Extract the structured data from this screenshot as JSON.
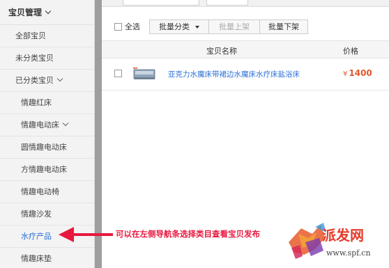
{
  "sidebar": {
    "header": "宝贝管理",
    "items": [
      {
        "label": "全部宝贝"
      },
      {
        "label": "未分类宝贝"
      },
      {
        "label": "已分类宝贝"
      },
      {
        "label": "情趣红床"
      },
      {
        "label": "情趣电动床"
      },
      {
        "label": "圆情趣电动床"
      },
      {
        "label": "方情趣电动床"
      },
      {
        "label": "情趣电动椅"
      },
      {
        "label": "情趣沙发"
      },
      {
        "label": "水疗产品"
      },
      {
        "label": "情趣床垫"
      }
    ]
  },
  "toolbar": {
    "select_all": "全选",
    "batch_category": "批量分类",
    "batch_list": "批量上架",
    "batch_delist": "批量下架"
  },
  "table": {
    "headers": [
      "宝贝名称",
      "价格"
    ],
    "rows": [
      {
        "name": "亚克力水魔床带裙边水魔床水疗床盐浴床",
        "currency": "¥",
        "price": "1400"
      }
    ]
  },
  "annotation": {
    "text": "可以在左侧导航条选择类目查看宝贝发布",
    "color": "#e8183f"
  },
  "watermark": {
    "brand": "派发网",
    "url": "www.spf.cn"
  },
  "colors": {
    "link": "#2a6fd6",
    "price": "#e4572e",
    "annotation": "#e8183f"
  }
}
